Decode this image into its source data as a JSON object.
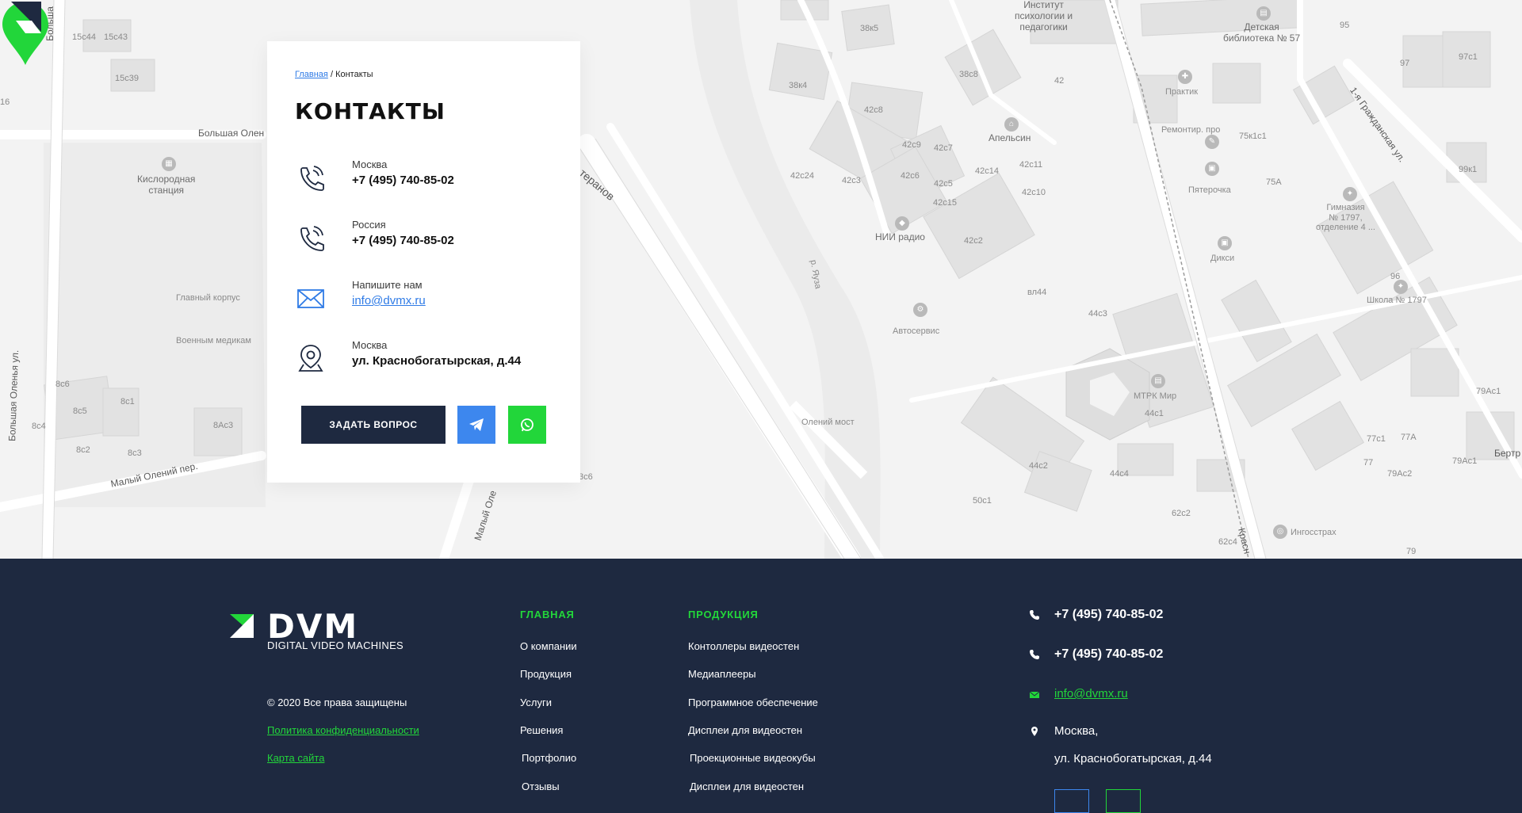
{
  "breadcrumb": {
    "home": "Главная",
    "separator": "/",
    "current": "Контакты"
  },
  "page_title": "КОНТАКТЫ",
  "contacts": [
    {
      "label": "Москва",
      "value": "+7 (495) 740-85-02",
      "icon": "phone-icon"
    },
    {
      "label": "Россия",
      "value": "+7 (495) 740-85-02",
      "icon": "phone-icon"
    },
    {
      "label": "Напишите нам",
      "value": "info@dvmx.ru",
      "icon": "mail-icon"
    },
    {
      "label": "Москва",
      "value": "ул. Краснобогатырская, д.44",
      "icon": "location-pin-icon"
    }
  ],
  "buttons": {
    "ask": "ЗАДАТЬ ВОПРОС",
    "telegram_icon": "telegram-icon",
    "whatsapp_icon": "whatsapp-icon"
  },
  "map": {
    "labels": {
      "inst": "Институт\nпсихологии и\nпедагогики",
      "lib": "Детская\nбиблиотека № 57",
      "oxygen": "Кислородная\nстанция",
      "main_building": "Главный корпус",
      "military": "Военным медикам",
      "apelsin": "Апельсин",
      "nii": "НИИ радио",
      "autoservice": "Автосервис",
      "praktik": "Практик",
      "repair": "Ремонтир. про",
      "pyaterochka": "Пятерочка",
      "dixy": "Дикси",
      "gymnasium": "Гимназия\n№ 1797,\nотделение 4 ...",
      "school": "Школа № 1797",
      "mtrk": "МТРК Мир",
      "ingosstrakh": "Ингосстрах",
      "olenij_most": "Олений мост",
      "yauza": "р. Яуза",
      "b_olenya": "Большая Олен",
      "b_olenya_ul": "Большая Оленья ул.",
      "m_olenij": "Малый Олений пер.",
      "m_ole": "Малый Оле",
      "bolsha": "Больша",
      "grazhd": "1-я Гражданская ул.",
      "kras": "Красн",
      "geranov": "теранов",
      "bertr": "Бертр",
      "n15c44": "15с44",
      "n15c43": "15с43",
      "n15c39": "15с39",
      "n38k5": "38к5",
      "n38k4": "38к4",
      "n38c8": "38с8",
      "n42": "42",
      "n42c8": "42с8",
      "n42c9": "42с9",
      "n42c7": "42с7",
      "n42c6": "42с6",
      "n42c5": "42с5",
      "n42c15": "42с15",
      "n42c14": "42с14",
      "n42c11": "42с11",
      "n42c10": "42с10",
      "n42c24": "42с24",
      "n42c3": "42с3",
      "n42c2": "42с2",
      "n44c3": "44с3",
      "n44c1": "44с1",
      "n44c2": "44с2",
      "n44c4": "44с4",
      "n50c1": "50с1",
      "n62c2": "62с2",
      "n62c4": "62с4",
      "n75k1c1": "75к1с1",
      "n75a": "75А",
      "n77c1": "77с1",
      "n77a": "77А",
      "n77": "77",
      "n79ac1": "79Ас1",
      "n79ac2": "79Ас2",
      "n79": "79",
      "n97": "97",
      "n97c1": "97с1",
      "n95": "95",
      "n96": "96",
      "n99k1": "99к1",
      "n79a": "79Ас1",
      "n8c6": "8с6",
      "n8c1": "8с1",
      "n8c5": "8с5",
      "n8c4": "8с4",
      "n8ac3": "8Ас3",
      "n8c2": "8с2",
      "n8c3": "8с3",
      "n3c6": "3с6",
      "vl44": "вл44",
      "n79a2": "79А",
      "n16": "16"
    }
  },
  "footer": {
    "logo_text": "DVM",
    "logo_sub": "DIGITAL VIDEO MACHINES",
    "copyright": "© 2020 Все права защищены",
    "privacy": "Политика конфиденциальности",
    "sitemap": "Карта сайта",
    "col1": {
      "title": "ГЛАВНАЯ",
      "items": [
        "О компании",
        "Продукция",
        "Услуги",
        "Решения",
        "Портфолио",
        "Отзывы"
      ]
    },
    "col2": {
      "title": "ПРОДУКЦИЯ",
      "items": [
        "Контоллеры видеостен",
        "Медиаплееры",
        "Программное обеспечение",
        "Дисплеи для видеостен",
        "Проекционные видеокубы",
        "Дисплеи для видеостен"
      ]
    },
    "contacts": {
      "phone1": "+7 (495) 740-85-02",
      "phone2": "+7 (495) 740-85-02",
      "email": "info@dvmx.ru",
      "city": "Москва,",
      "street": "ул. Краснобогатырская, д.44"
    }
  },
  "colors": {
    "accent_green": "#22d63a",
    "navy": "#1e2940",
    "link_blue": "#2f7be6",
    "telegram_blue": "#3d87ee"
  }
}
